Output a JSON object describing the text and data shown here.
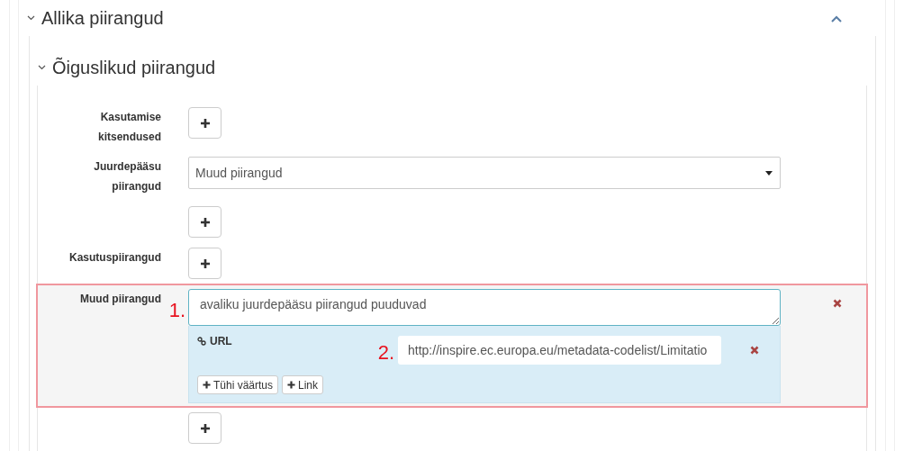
{
  "outer_section": {
    "title": "Allika piirangud",
    "expanded": true
  },
  "inner_section": {
    "title": "Õiguslikud piirangud",
    "expanded": true
  },
  "rows": [
    {
      "kind": "add",
      "label": "Kasutamise kitsendused"
    },
    {
      "kind": "select",
      "label": "Juurdepääsu piirangud",
      "value": "Muud piirangud"
    },
    {
      "kind": "add",
      "label": ""
    },
    {
      "kind": "add",
      "label": "Kasutuspiirangud"
    },
    {
      "kind": "text",
      "label": "Muud piirangud",
      "highlighted": true,
      "annotation": "1.",
      "value": "avaliku juurdepääsu piirangud puuduvad",
      "link": {
        "label": "URL",
        "annotation": "2.",
        "value": "http://inspire.ec.europa.eu/metadata-codelist/Limitatio",
        "buttons": [
          "Tühi väärtus",
          "Link"
        ]
      }
    },
    {
      "kind": "add",
      "label": ""
    }
  ]
}
